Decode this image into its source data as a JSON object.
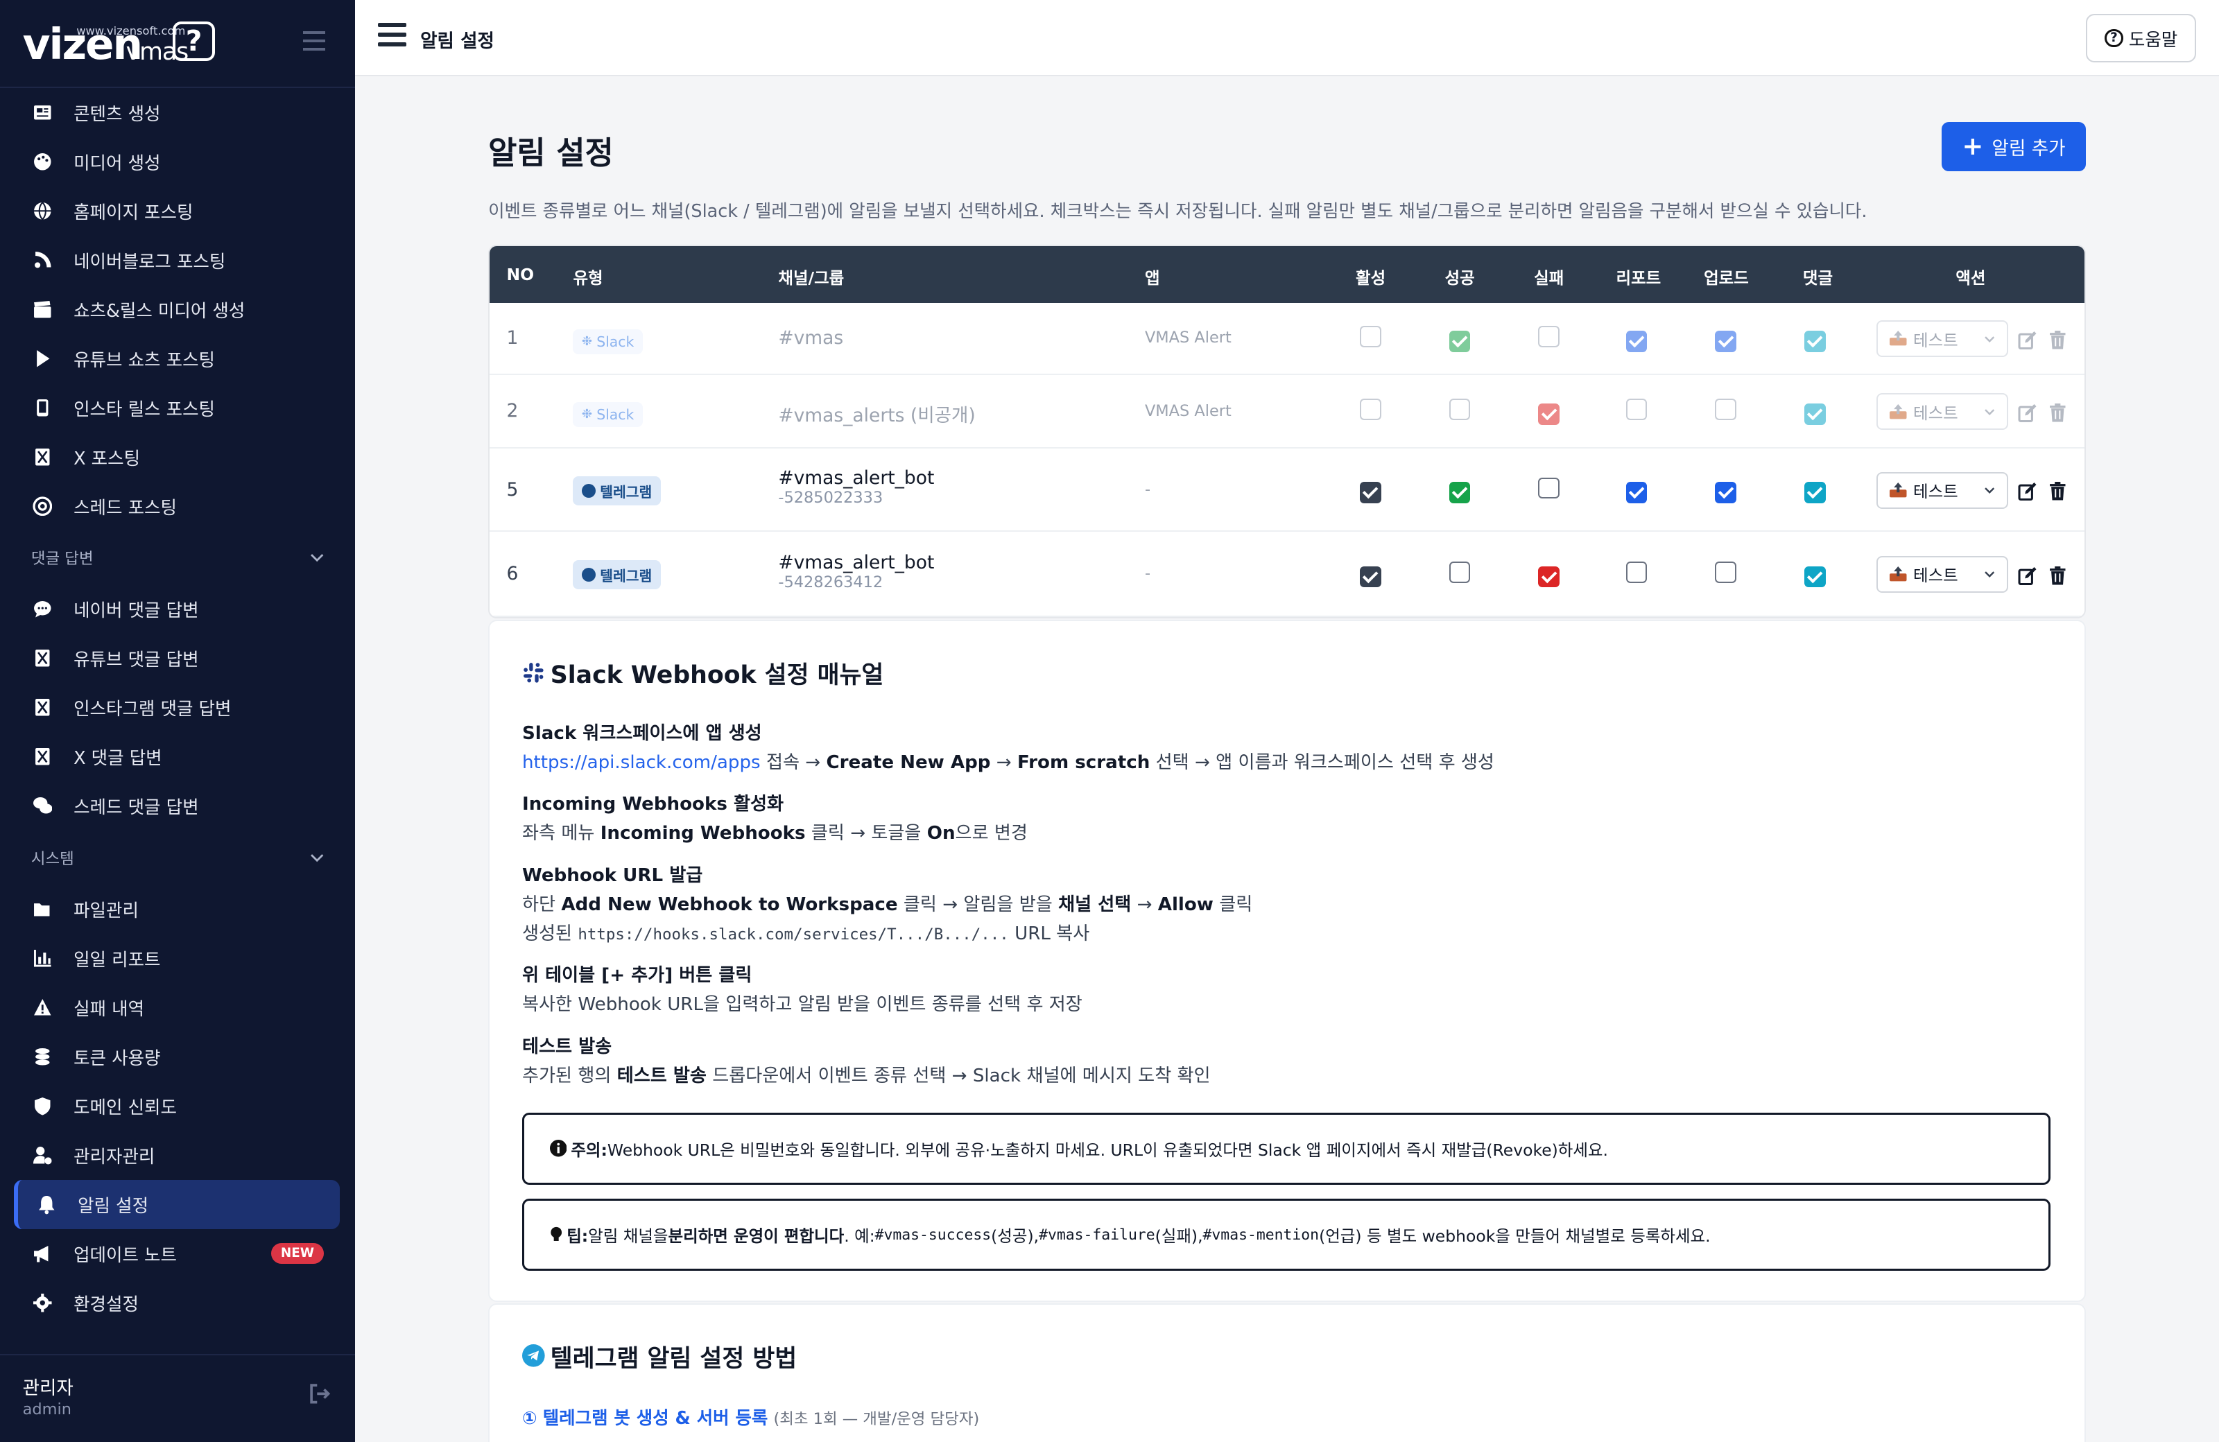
{
  "brand": {
    "name": "vizen",
    "product": "vmas",
    "url": "www.vizensoft.com",
    "mark": "?"
  },
  "sidebar": {
    "group_main": [
      {
        "label": "콘텐츠 생성",
        "icon": "newspaper-icon"
      },
      {
        "label": "미디어 생성",
        "icon": "palette-icon"
      },
      {
        "label": "홈페이지 포스팅",
        "icon": "globe-icon"
      },
      {
        "label": "네이버블로그 포스팅",
        "icon": "blog-icon"
      },
      {
        "label": "쇼츠&릴스 미디어 생성",
        "icon": "clapper-icon"
      },
      {
        "label": "유튜브 쇼츠 포스팅",
        "icon": "play-icon"
      },
      {
        "label": "인스타 릴스 포스팅",
        "icon": "phone-icon"
      },
      {
        "label": "X 포스팅",
        "icon": "x-icon"
      },
      {
        "label": "스레드 포스팅",
        "icon": "at-icon"
      }
    ],
    "section_comments": "댓글 답변",
    "group_comments": [
      {
        "label": "네이버 댓글 답변",
        "icon": "comment-icon"
      },
      {
        "label": "유튜브 댓글 답변",
        "icon": "x-icon"
      },
      {
        "label": "인스타그램 댓글 답변",
        "icon": "x-icon"
      },
      {
        "label": "X 댓글 답변",
        "icon": "x-icon"
      },
      {
        "label": "스레드 댓글 답변",
        "icon": "comments-icon"
      }
    ],
    "section_system": "시스템",
    "group_system": [
      {
        "label": "파일관리",
        "icon": "folder-icon"
      },
      {
        "label": "일일 리포트",
        "icon": "chart-icon"
      },
      {
        "label": "실패 내역",
        "icon": "warning-icon"
      },
      {
        "label": "토큰 사용량",
        "icon": "coins-icon"
      },
      {
        "label": "도메인 신뢰도",
        "icon": "shield-icon"
      },
      {
        "label": "관리자관리",
        "icon": "user-gear-icon"
      },
      {
        "label": "알림 설정",
        "icon": "bell-icon"
      },
      {
        "label": "업데이트 노트",
        "icon": "megaphone-icon",
        "badge": "NEW"
      },
      {
        "label": "환경설정",
        "icon": "gear-icon"
      }
    ],
    "user": {
      "name": "관리자",
      "role": "admin"
    }
  },
  "topbar": {
    "title": "알림 설정",
    "help": "도움말"
  },
  "page": {
    "title": "알림 설정",
    "add_button": "알림 추가",
    "description": "이벤트 종류별로 어느 채널(Slack / 텔레그램)에 알림을 보낼지 선택하세요. 체크박스는 즉시 저장됩니다. 실패 알림만 별도 채널/그룹으로 분리하면 알림음을 구분해서 받으실 수 있습니다."
  },
  "table": {
    "headers": {
      "no": "NO",
      "type": "유형",
      "channel": "채널/그룹",
      "app": "앱",
      "active": "활성",
      "success": "성공",
      "fail": "실패",
      "report": "리포트",
      "upload": "업로드",
      "comment": "댓글",
      "action": "액션"
    },
    "rows": [
      {
        "no": "1",
        "type": "Slack",
        "channel": "#vmas",
        "sub": "",
        "app": "VMAS Alert",
        "test": "테스트",
        "active": false,
        "success": true,
        "fail": false,
        "report": true,
        "upload": true,
        "comment": true
      },
      {
        "no": "2",
        "type": "Slack",
        "channel": "#vmas_alerts (비공개)",
        "sub": "",
        "app": "VMAS Alert",
        "test": "테스트",
        "active": false,
        "success": false,
        "fail": true,
        "report": false,
        "upload": false,
        "comment": true
      },
      {
        "no": "5",
        "type": "텔레그램",
        "channel": "#vmas_alert_bot",
        "sub": "-5285022333",
        "app": "-",
        "test": "테스트",
        "active": true,
        "success": true,
        "fail": false,
        "report": true,
        "upload": true,
        "comment": true
      },
      {
        "no": "6",
        "type": "텔레그램",
        "channel": "#vmas_alert_bot",
        "sub": "-5428263412",
        "app": "-",
        "test": "테스트",
        "active": true,
        "success": false,
        "fail": true,
        "report": false,
        "upload": false,
        "comment": true
      }
    ]
  },
  "colors": {
    "success": "#16a34a",
    "fail": "#dc2626",
    "report": "#1d5fe8",
    "upload": "#1d5fe8",
    "comment": "#0ea5c6",
    "active": "#374151",
    "sidebar_bg": "#0f1730",
    "accent": "#1d5fe8"
  },
  "slack_manual": {
    "title": "Slack Webhook 설정 매뉴얼",
    "s1_title": "Slack 워크스페이스에 앱 생성",
    "s1_link": "https://api.slack.com/apps",
    "s1_a": " 접속 → ",
    "s1_b": "Create New App",
    "s1_c": " → ",
    "s1_d": "From scratch",
    "s1_e": " 선택 → 앱 이름과 워크스페이스 선택 후 생성",
    "s2_title": "Incoming Webhooks 활성화",
    "s2_a": "좌측 메뉴 ",
    "s2_b": "Incoming Webhooks",
    "s2_c": " 클릭 → 토글을 ",
    "s2_d": "On",
    "s2_e": "으로 변경",
    "s3_title": "Webhook URL 발급",
    "s3_a": "하단 ",
    "s3_b": "Add New Webhook to Workspace",
    "s3_c": " 클릭 → 알림을 받을 ",
    "s3_d": "채널 선택",
    "s3_e": " → ",
    "s3_f": "Allow",
    "s3_g": " 클릭",
    "s3_h": "생성된 ",
    "s3_code": "https://hooks.slack.com/services/T.../B.../...",
    "s3_i": " URL 복사",
    "s4_title": "위 테이블 [+ 추가] 버튼 클릭",
    "s4_body": "복사한 Webhook URL을 입력하고 알림 받을 이벤트 종류를 선택 후 저장",
    "s5_title": "테스트 발송",
    "s5_a": "추가된 행의 ",
    "s5_b": "테스트 발송",
    "s5_c": " 드롭다운에서 이벤트 종류 선택 → Slack 채널에 메시지 도착 확인",
    "warn_label": "주의:",
    "warn_body": " Webhook URL은 비밀번호와 동일합니다. 외부에 공유·노출하지 마세요. URL이 유출되었다면 Slack 앱 페이지에서 즉시 재발급(Revoke)하세요.",
    "tip_label": "팁:",
    "tip_a": " 알림 채널을 ",
    "tip_b": "분리하면 운영이 편합니다",
    "tip_c": ". 예: ",
    "tip_code1": "#vmas-success",
    "tip_d": "(성공), ",
    "tip_code2": "#vmas-failure",
    "tip_e": "(실패), ",
    "tip_code3": "#vmas-mention",
    "tip_f": "(언급) 등 별도 webhook을 만들어 채널별로 등록하세요."
  },
  "telegram_manual": {
    "title": "텔레그램 알림 설정 방법",
    "step1_num": "①",
    "step1_title": "텔레그램 봇 생성 & 서버 등록",
    "step1_note": "(최초 1회 — 개발/운영 담당자)"
  }
}
